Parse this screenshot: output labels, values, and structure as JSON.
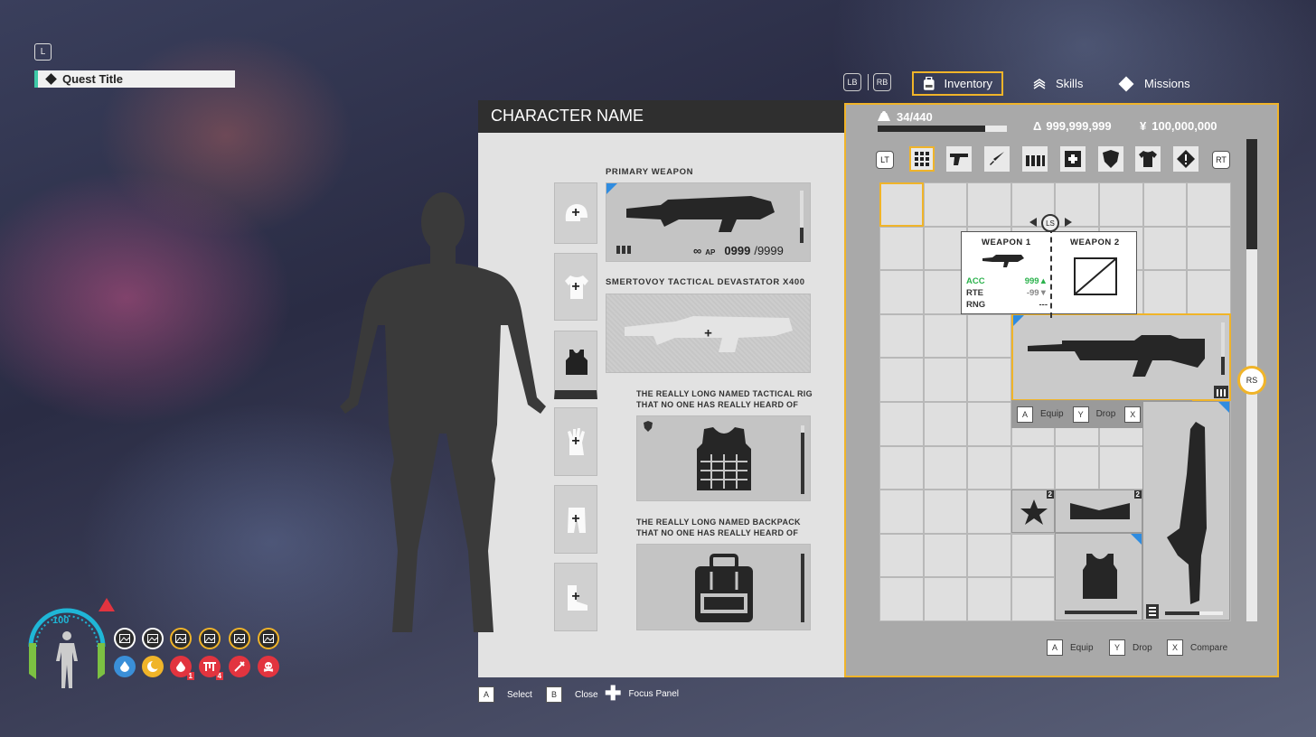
{
  "quest": {
    "key": "L",
    "title": "Quest Title"
  },
  "tabs": {
    "lb": "LB",
    "rb": "RB",
    "items": [
      {
        "label": "Inventory",
        "icon": "backpack-icon"
      },
      {
        "label": "Skills",
        "icon": "chevrons-up-icon"
      },
      {
        "label": "Missions",
        "icon": "diamond-icon"
      }
    ],
    "active": "Inventory"
  },
  "character": {
    "name": "CHARACTER NAME"
  },
  "equipment": {
    "primary_label": "PRIMARY WEAPON",
    "primary_ammo": "0999",
    "primary_ammo_max": "/9999",
    "ammo_type": "AP",
    "ammo_infinite": "∞",
    "secondary_label": "SMERTOVOY TACTICAL DEVASTATOR X400",
    "rig_label_1": "THE REALLY LONG NAMED TACTICAL RIG",
    "rig_label_2": "THAT NO ONE HAS REALLY HEARD OF",
    "pack_label_1": "THE REALLY LONG NAMED BACKPACK",
    "pack_label_2": "THAT NO ONE HAS REALLY HEARD OF",
    "slots": [
      "helmet-icon",
      "shirt-icon",
      "vest-icon",
      "glove-icon",
      "pants-icon",
      "boot-icon"
    ],
    "primary_ammo_fill": 0.3,
    "rig_durability": 0.9,
    "pack_durability": 1.0
  },
  "inventory": {
    "weight": "34/440",
    "weight_fill": 0.83,
    "credits": "999,999,999",
    "credits_symbol": "Δ",
    "money": "100,000,000",
    "money_symbol": "¥",
    "lt": "LT",
    "rt": "RT",
    "ls": "LS",
    "rs": "RS",
    "categories": [
      "grid-icon",
      "pistol-icon",
      "knife-icon",
      "ammo-icon",
      "medkit-icon",
      "shield-icon",
      "shirt-icon",
      "alert-icon"
    ],
    "compare": {
      "w1": "WEAPON 1",
      "w2": "WEAPON 2",
      "stats": [
        {
          "name": "ACC",
          "value": "999",
          "arrow": "▲",
          "color": "#2bb24c"
        },
        {
          "name": "RTE",
          "value": "-99",
          "arrow": "▼",
          "color": "#888"
        },
        {
          "name": "RNG",
          "value": "---",
          "arrow": "",
          "color": "#333"
        }
      ]
    },
    "item_actions": [
      {
        "key": "A",
        "label": "Equip"
      },
      {
        "key": "Y",
        "label": "Drop"
      },
      {
        "key": "X",
        "label": "Compare"
      }
    ],
    "stack_counts": [
      "2",
      "2"
    ]
  },
  "footer": [
    {
      "key": "A",
      "label": "Select"
    },
    {
      "key": "B",
      "label": "Close"
    },
    {
      "key": "✚",
      "label": "Focus Panel"
    }
  ],
  "hud": {
    "health": "100",
    "status_counts": [
      "1",
      "4"
    ]
  },
  "colors": {
    "accent": "#f0b429",
    "quest_marker": "#3ec9a8",
    "hud_cyan": "#1fb6d6",
    "hud_green": "#7cc142",
    "danger": "#e2343f"
  }
}
